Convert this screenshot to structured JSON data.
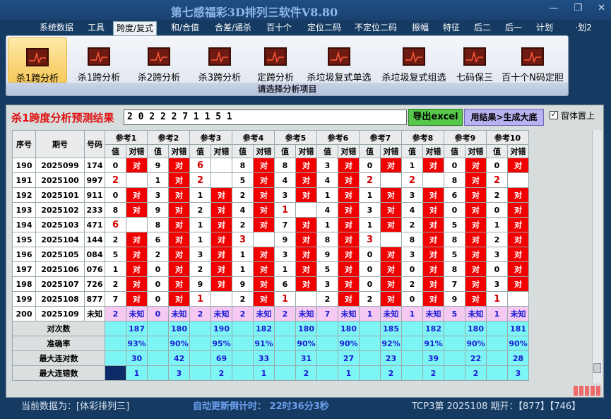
{
  "window": {
    "title": "第七感福彩3D排列三软件V8.80",
    "controls": [
      "—",
      "❐",
      "✕"
    ]
  },
  "menu": [
    "系统数据",
    "工具",
    "跨度/复式",
    "和/合值",
    "合差/通杀",
    "百十个",
    "定位二码",
    "不定位二码",
    "振幅",
    "特征",
    "后二",
    "后一",
    "计划",
    "·划2"
  ],
  "menu_active": 2,
  "ribbon": {
    "buttons": [
      "杀1跨分析",
      "杀1跨分析",
      "杀2跨分析",
      "杀3跨分析",
      "定跨分析",
      "杀垃圾复式单选",
      "杀垃圾复式组选",
      "七码保三",
      "百十个N码定胆"
    ],
    "selected": 0,
    "footer": "请选择分析项目"
  },
  "result": {
    "title": "杀1跨度分析预测结果",
    "numbers": "2 0 2 2 2 7 1 1 5 1",
    "export_btn": "导出excel",
    "generate_btn": "用结果>生成大底",
    "topmost_label": "窗体置上",
    "topmost_checked": true
  },
  "table": {
    "headers": {
      "seq": "序号",
      "period": "期号",
      "code": "号码",
      "val": "值",
      "hit": "对错"
    },
    "ref_names": [
      "参考1",
      "参考2",
      "参考3",
      "参考4",
      "参考5",
      "参考6",
      "参考7",
      "参考8",
      "参考9",
      "参考10"
    ],
    "rows": [
      {
        "seq": "190",
        "period": "2025099",
        "code": "174",
        "cells": [
          [
            "0",
            "对"
          ],
          [
            "9",
            "对"
          ],
          [
            "6",
            ""
          ],
          [
            "8",
            "对"
          ],
          [
            "8",
            "对"
          ],
          [
            "3",
            "对"
          ],
          [
            "0",
            "对"
          ],
          [
            "1",
            "对"
          ],
          [
            "0",
            "对"
          ],
          [
            "0",
            "对"
          ]
        ]
      },
      {
        "seq": "191",
        "period": "2025100",
        "code": "997",
        "cells": [
          [
            "2",
            ""
          ],
          [
            "1",
            "对"
          ],
          [
            "2",
            ""
          ],
          [
            "5",
            "对"
          ],
          [
            "4",
            "对"
          ],
          [
            "4",
            "对"
          ],
          [
            "2",
            ""
          ],
          [
            "2",
            ""
          ],
          [
            "8",
            "对"
          ],
          [
            "2",
            ""
          ]
        ]
      },
      {
        "seq": "192",
        "period": "2025101",
        "code": "911",
        "cells": [
          [
            "0",
            "对"
          ],
          [
            "3",
            "对"
          ],
          [
            "1",
            "对"
          ],
          [
            "2",
            "对"
          ],
          [
            "3",
            "对"
          ],
          [
            "1",
            "对"
          ],
          [
            "1",
            "对"
          ],
          [
            "3",
            "对"
          ],
          [
            "6",
            "对"
          ],
          [
            "2",
            "对"
          ]
        ]
      },
      {
        "seq": "193",
        "period": "2025102",
        "code": "233",
        "cells": [
          [
            "8",
            "对"
          ],
          [
            "9",
            "对"
          ],
          [
            "2",
            "对"
          ],
          [
            "4",
            "对"
          ],
          [
            "1",
            ""
          ],
          [
            "4",
            "对"
          ],
          [
            "3",
            "对"
          ],
          [
            "4",
            "对"
          ],
          [
            "0",
            "对"
          ],
          [
            "0",
            "对"
          ]
        ]
      },
      {
        "seq": "194",
        "period": "2025103",
        "code": "471",
        "cells": [
          [
            "6",
            ""
          ],
          [
            "8",
            "对"
          ],
          [
            "1",
            "对"
          ],
          [
            "2",
            "对"
          ],
          [
            "7",
            "对"
          ],
          [
            "1",
            "对"
          ],
          [
            "1",
            "对"
          ],
          [
            "2",
            "对"
          ],
          [
            "5",
            "对"
          ],
          [
            "1",
            "对"
          ]
        ]
      },
      {
        "seq": "195",
        "period": "2025104",
        "code": "144",
        "cells": [
          [
            "2",
            "对"
          ],
          [
            "6",
            "对"
          ],
          [
            "1",
            "对"
          ],
          [
            "3",
            ""
          ],
          [
            "9",
            "对"
          ],
          [
            "8",
            "对"
          ],
          [
            "3",
            ""
          ],
          [
            "8",
            "对"
          ],
          [
            "8",
            "对"
          ],
          [
            "2",
            "对"
          ]
        ]
      },
      {
        "seq": "196",
        "period": "2025105",
        "code": "084",
        "cells": [
          [
            "5",
            "对"
          ],
          [
            "2",
            "对"
          ],
          [
            "3",
            "对"
          ],
          [
            "1",
            "对"
          ],
          [
            "3",
            "对"
          ],
          [
            "9",
            "对"
          ],
          [
            "0",
            "对"
          ],
          [
            "3",
            "对"
          ],
          [
            "5",
            "对"
          ],
          [
            "3",
            "对"
          ]
        ]
      },
      {
        "seq": "197",
        "period": "2025106",
        "code": "076",
        "cells": [
          [
            "1",
            "对"
          ],
          [
            "0",
            "对"
          ],
          [
            "2",
            "对"
          ],
          [
            "1",
            "对"
          ],
          [
            "1",
            "对"
          ],
          [
            "5",
            "对"
          ],
          [
            "0",
            "对"
          ],
          [
            "0",
            "对"
          ],
          [
            "8",
            "对"
          ],
          [
            "0",
            "对"
          ]
        ]
      },
      {
        "seq": "198",
        "period": "2025107",
        "code": "726",
        "cells": [
          [
            "2",
            "对"
          ],
          [
            "0",
            "对"
          ],
          [
            "9",
            "对"
          ],
          [
            "9",
            "对"
          ],
          [
            "6",
            "对"
          ],
          [
            "3",
            "对"
          ],
          [
            "0",
            "对"
          ],
          [
            "2",
            "对"
          ],
          [
            "7",
            "对"
          ],
          [
            "3",
            "对"
          ]
        ]
      },
      {
        "seq": "199",
        "period": "2025108",
        "code": "877",
        "cells": [
          [
            "7",
            "对"
          ],
          [
            "0",
            "对"
          ],
          [
            "1",
            ""
          ],
          [
            "2",
            "对"
          ],
          [
            "1",
            ""
          ],
          [
            "2",
            "对"
          ],
          [
            "2",
            "对"
          ],
          [
            "0",
            "对"
          ],
          [
            "9",
            "对"
          ],
          [
            "1",
            ""
          ]
        ]
      }
    ],
    "last_row": {
      "seq": "200",
      "period": "2025109",
      "code": "未知",
      "vals": [
        "2",
        "0",
        "2",
        "2",
        "2",
        "7",
        "1",
        "1",
        "5",
        "1"
      ],
      "unknown": "未知"
    },
    "stats": [
      {
        "label": "对次数",
        "values": [
          "187",
          "180",
          "190",
          "182",
          "180",
          "180",
          "185",
          "182",
          "180",
          "181"
        ]
      },
      {
        "label": "准确率",
        "values": [
          "93%",
          "90%",
          "95%",
          "91%",
          "90%",
          "90%",
          "92%",
          "91%",
          "90%",
          "90%"
        ]
      },
      {
        "label": "最大连对数",
        "values": [
          "30",
          "42",
          "69",
          "33",
          "31",
          "27",
          "23",
          "39",
          "22",
          "28"
        ]
      },
      {
        "label": "最大连错数",
        "values": [
          "1",
          "3",
          "2",
          "1",
          "2",
          "1",
          "2",
          "2",
          "2",
          "3"
        ]
      }
    ]
  },
  "status": {
    "current": "当前数据为：[体彩排列三]",
    "countdown": "自动更新倒计时：  22时36分3秒",
    "draw": "TCP3第 2025108 期开：【877】【746】"
  },
  "colors": {
    "hit": "#f10000",
    "stat_bg": "#7ef5f5",
    "last_row_bg": "#f5c9f2",
    "accent_blue": "#1a1ad6"
  }
}
